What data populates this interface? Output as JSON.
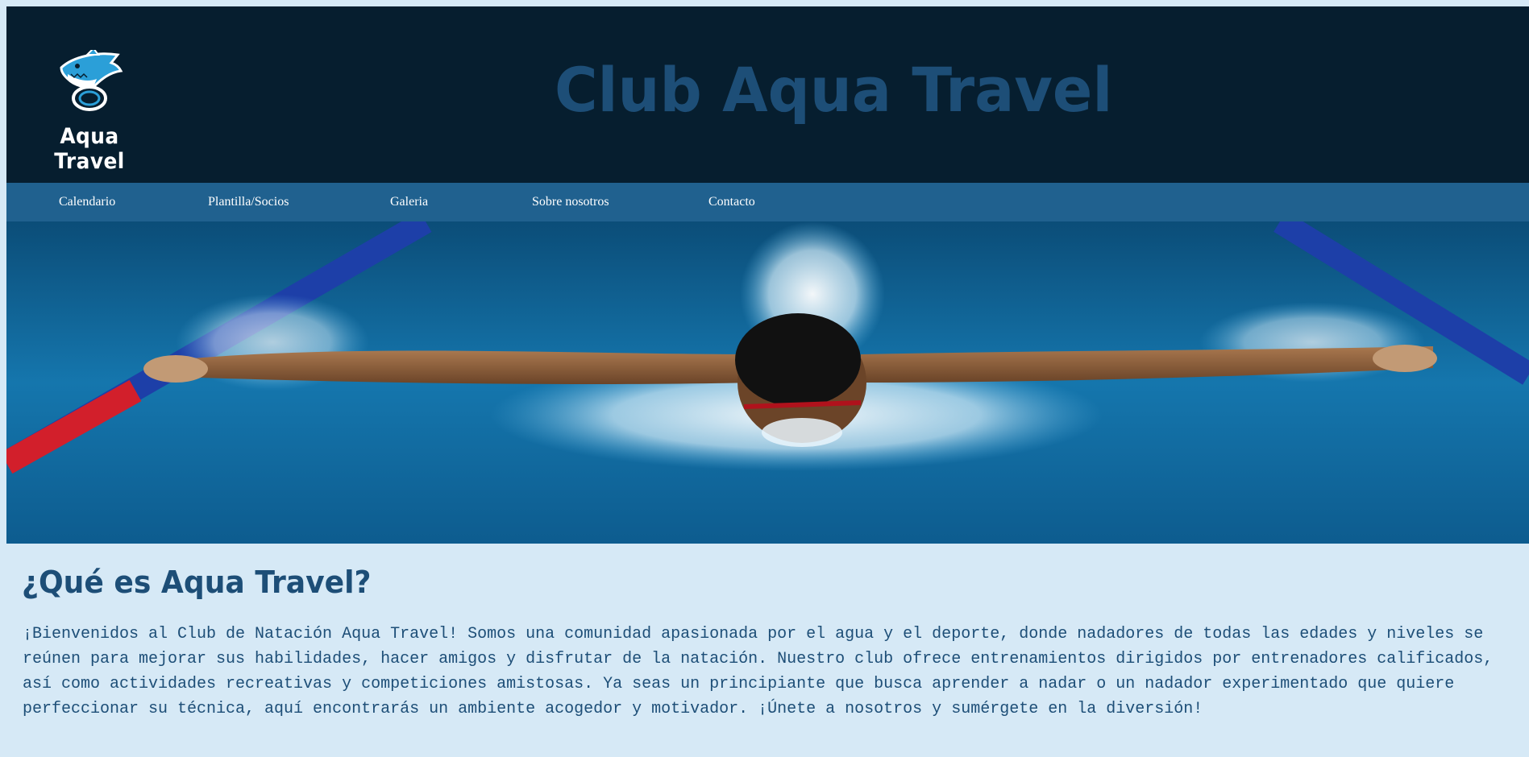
{
  "header": {
    "logo_text": "Aqua Travel",
    "logo_icon": "shark-mascot-icon",
    "title": "Club Aqua Travel"
  },
  "nav": {
    "items": [
      {
        "label": "Calendario"
      },
      {
        "label": "Plantilla/Socios"
      },
      {
        "label": "Galeria"
      },
      {
        "label": "Sobre nosotros"
      },
      {
        "label": "Contacto"
      }
    ]
  },
  "hero": {
    "image": "butterfly-swimmer-pool-photo"
  },
  "about": {
    "title": "¿Qué es Aqua Travel?",
    "text": "¡Bienvenidos al Club de Natación Aqua Travel! Somos una comunidad apasionada por el agua y el deporte, donde nadadores de todas las edades y niveles se reúnen para mejorar sus habilidades, hacer amigos y disfrutar de la natación. Nuestro club ofrece entrenamientos dirigidos por entrenadores calificados, así como actividades recreativas y competiciones amistosas. Ya seas un principiante que busca aprender a nadar o un nadador experimentado que quiere perfeccionar su técnica, aquí encontrarás un ambiente acogedor y motivador. ¡Únete a nosotros y sumérgete en la diversión!"
  },
  "colors": {
    "header_bg": "#061e2f",
    "nav_bg": "#20618f",
    "title": "#1d4e77",
    "page_bg": "#d6e9f6"
  }
}
